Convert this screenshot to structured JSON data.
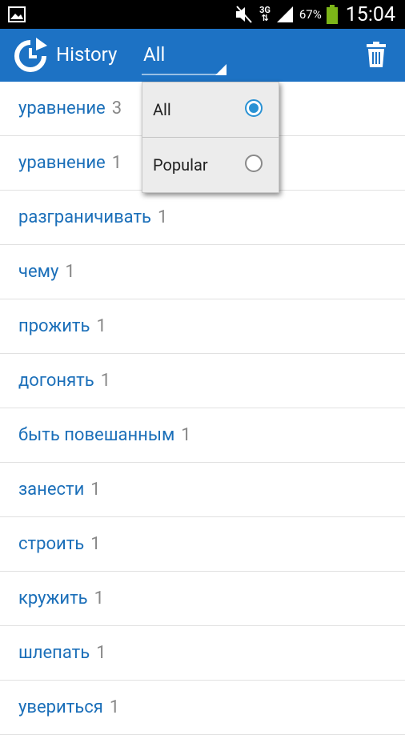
{
  "status_bar": {
    "network": "3G",
    "battery_percent": "67%",
    "time": "15:04"
  },
  "action_bar": {
    "title": "History",
    "filter_selected": "All"
  },
  "filter_menu": {
    "options": [
      {
        "label": "All",
        "selected": true
      },
      {
        "label": "Popular",
        "selected": false
      }
    ]
  },
  "history": {
    "items": [
      {
        "word": "уравнение",
        "count": "3"
      },
      {
        "word": "уравнение",
        "count": "1"
      },
      {
        "word": "разграничивать",
        "count": "1"
      },
      {
        "word": "чему",
        "count": "1"
      },
      {
        "word": "прожить",
        "count": "1"
      },
      {
        "word": "догонять",
        "count": "1"
      },
      {
        "word": "быть повешанным",
        "count": "1"
      },
      {
        "word": "занести",
        "count": "1"
      },
      {
        "word": "строить",
        "count": "1"
      },
      {
        "word": "кружить",
        "count": "1"
      },
      {
        "word": "шлепать",
        "count": "1"
      },
      {
        "word": "увериться",
        "count": "1"
      }
    ]
  },
  "colors": {
    "action_bar": "#1d72c4",
    "word_text": "#1b6fb9",
    "count_text": "#888888",
    "radio_selected": "#2a92d4"
  }
}
